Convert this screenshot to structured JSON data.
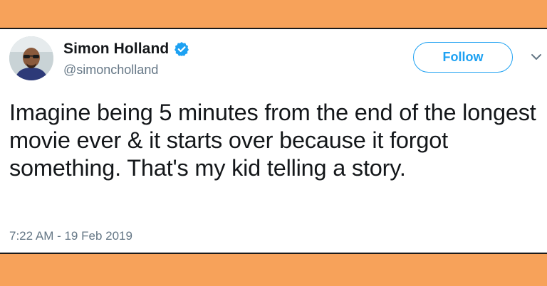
{
  "user": {
    "display_name": "Simon Holland",
    "handle": "@simoncholland",
    "verified": true,
    "avatar_icon": "profile-photo-icon"
  },
  "actions": {
    "follow_label": "Follow",
    "menu_icon": "chevron-down-icon"
  },
  "tweet": {
    "text": "Imagine being 5 minutes from the end of the longest movie ever & it starts over because it forgot something. That's my kid telling a story.",
    "timestamp": "7:22 AM - 19 Feb 2019"
  },
  "colors": {
    "frame": "#f7a25a",
    "accent": "#1da1f2",
    "text": "#14171a",
    "secondary_text": "#657786"
  }
}
